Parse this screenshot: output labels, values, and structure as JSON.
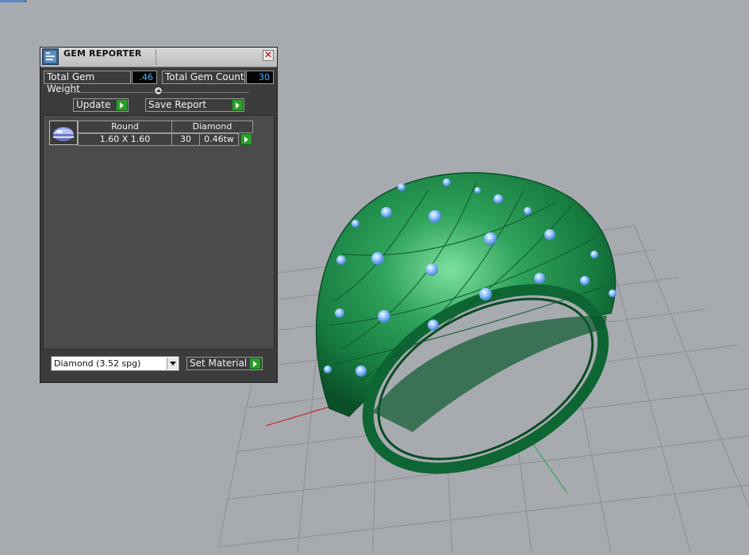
{
  "panel": {
    "title": "GEM REPORTER",
    "close_glyph": "✕",
    "total_weight_label": "Total Gem Weight",
    "total_weight_value": ".46",
    "total_count_label": "Total Gem Count",
    "total_count_value": "30",
    "update_label": "Update",
    "save_report_label": "Save Report",
    "gem_rows": [
      {
        "shape": "Round",
        "size": "1.60 X 1.60",
        "material": "Diamond",
        "count": "30",
        "weight": "0.46tw"
      }
    ],
    "material_select_value": "Diamond    (3.52 spg)",
    "set_material_label": "Set Material"
  },
  "icons": {
    "app": "gem-reporter-icon",
    "close": "close-icon",
    "go": "play-arrow-icon",
    "gem": "round-gem-icon",
    "dropdown": "chevron-down-icon"
  },
  "colors": {
    "panel_bg": "#3c3c3c",
    "value_text": "#42b6ff",
    "go_button": "#2e9a2e",
    "viewport_bg": "#a7abaf",
    "ring_green": "#1f8f4a",
    "gem_blue": "#8fc3ff"
  }
}
